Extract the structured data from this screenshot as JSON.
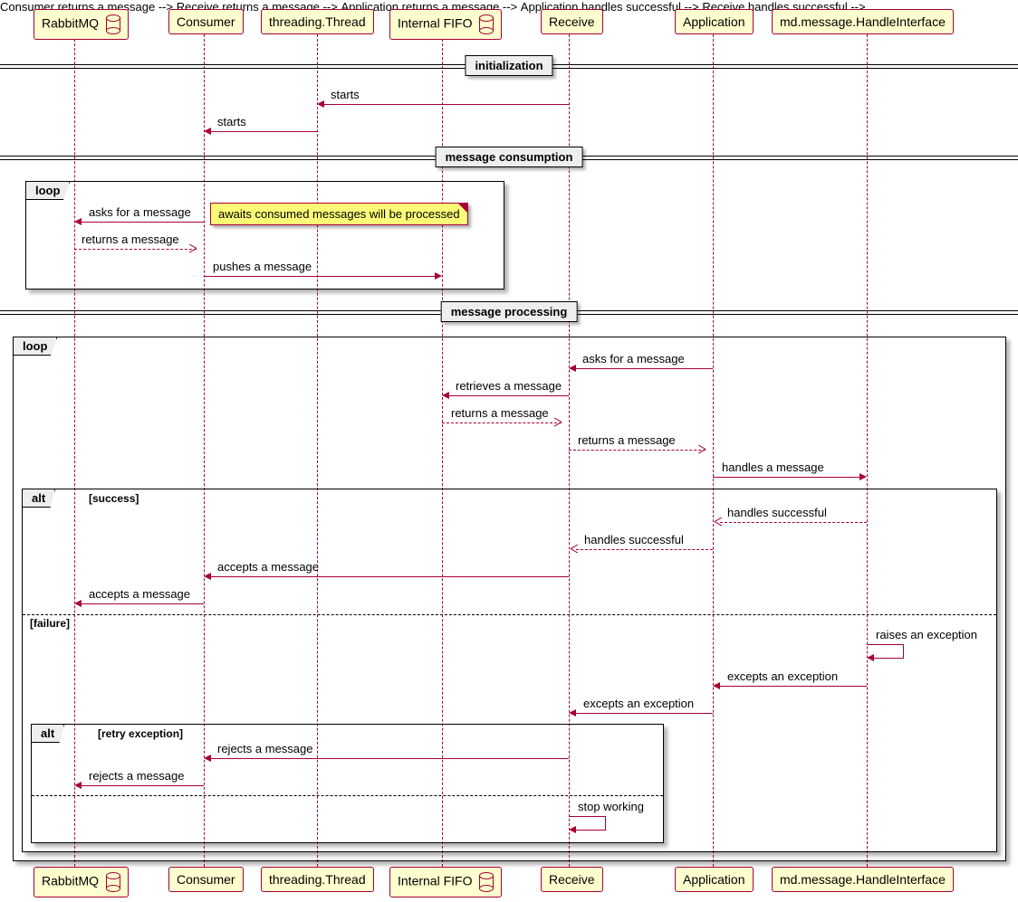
{
  "participants": {
    "rabbitmq": "RabbitMQ",
    "consumer": "Consumer",
    "thread": "threading.Thread",
    "fifo": "Internal FIFO",
    "receive": "Receive",
    "application": "Application",
    "handler": "md.message.HandleInterface"
  },
  "dividers": {
    "init": "initialization",
    "consumption": "message consumption",
    "processing": "message processing"
  },
  "fragments": {
    "loop1": "loop",
    "loop2": "loop",
    "alt1": "alt",
    "alt1_guard_success": "[success]",
    "alt1_guard_failure": "[failure]",
    "alt2": "alt",
    "alt2_guard_retry": "[retry exception]"
  },
  "note": "awaits consumed messages will be processed",
  "messages": {
    "m1": "starts",
    "m2": "starts",
    "m3": "asks for a message",
    "m4": "returns a message",
    "m5": "pushes a message",
    "m6": "asks for a message",
    "m7": "retrieves a message",
    "m8": "returns a message",
    "m9": "returns a message",
    "m10": "handles a message",
    "m11": "handles successful",
    "m12": "handles successful",
    "m13": "accepts a message",
    "m14": "accepts a message",
    "m15": "raises an exception",
    "m16": "excepts an exception",
    "m17": "excepts an exception",
    "m18": "rejects a message",
    "m19": "rejects a message",
    "m20": "stop working"
  }
}
